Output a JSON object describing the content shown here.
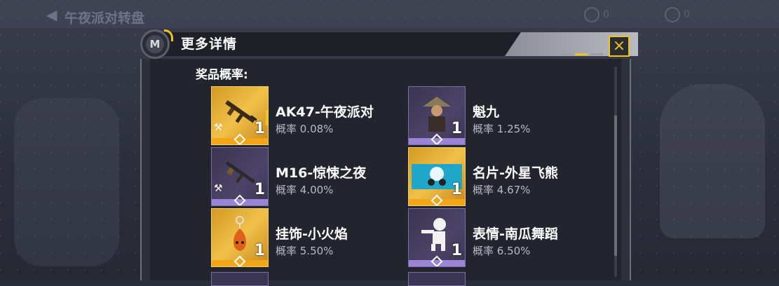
{
  "background": {
    "title": "午夜派对转盘",
    "currency_count_1": "0",
    "currency_count_2": "0"
  },
  "dialog": {
    "title": "更多详情",
    "badge_letter": "M",
    "close_icon": "×",
    "section_title": "奖品概率:"
  },
  "items": [
    {
      "name": "AK47-午夜派对",
      "prob": "概率 0.08%",
      "qty": "1",
      "rarity": "gold",
      "icon": "rifle-icon"
    },
    {
      "name": "魁九",
      "prob": "概率 1.25%",
      "qty": "1",
      "rarity": "purple",
      "icon": "character-icon"
    },
    {
      "name": "M16-惊悚之夜",
      "prob": "概率 4.00%",
      "qty": "1",
      "rarity": "purple",
      "icon": "rifle-icon"
    },
    {
      "name": "名片-外星飞熊",
      "prob": "概率 4.67%",
      "qty": "1",
      "rarity": "gold",
      "icon": "name-card-icon"
    },
    {
      "name": "挂饰-小火焰",
      "prob": "概率 5.50%",
      "qty": "1",
      "rarity": "gold",
      "icon": "charm-icon"
    },
    {
      "name": "表情-南瓜舞蹈",
      "prob": "概率 6.50%",
      "qty": "1",
      "rarity": "purple",
      "icon": "emote-icon"
    }
  ],
  "colors": {
    "gold": "#f0c419",
    "purple": "#9a84d6",
    "dialog_bg": "#23252e"
  }
}
